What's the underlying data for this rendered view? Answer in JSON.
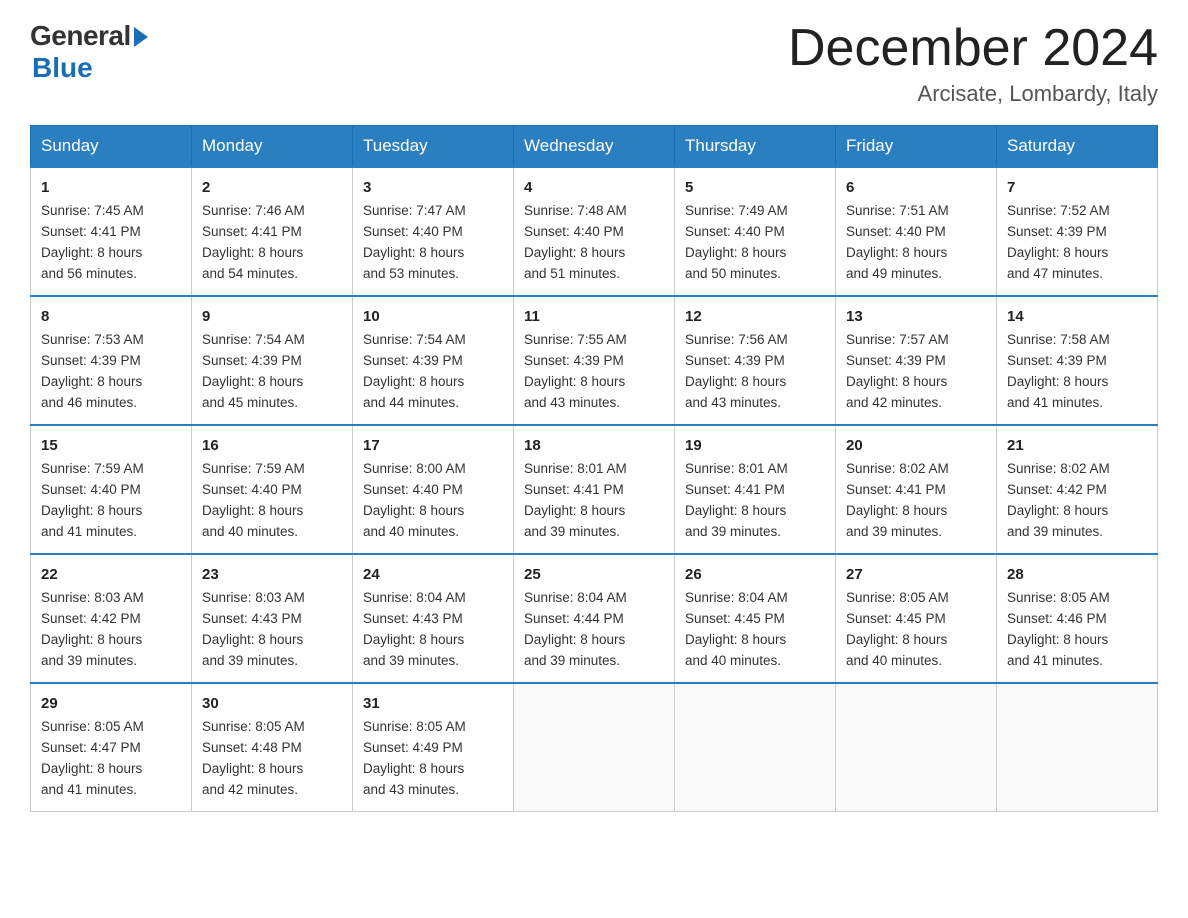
{
  "header": {
    "logo_general": "General",
    "logo_blue": "Blue",
    "month_title": "December 2024",
    "location": "Arcisate, Lombardy, Italy"
  },
  "days_of_week": [
    "Sunday",
    "Monday",
    "Tuesday",
    "Wednesday",
    "Thursday",
    "Friday",
    "Saturday"
  ],
  "weeks": [
    [
      {
        "day": "1",
        "sunrise": "7:45 AM",
        "sunset": "4:41 PM",
        "daylight": "8 hours and 56 minutes."
      },
      {
        "day": "2",
        "sunrise": "7:46 AM",
        "sunset": "4:41 PM",
        "daylight": "8 hours and 54 minutes."
      },
      {
        "day": "3",
        "sunrise": "7:47 AM",
        "sunset": "4:40 PM",
        "daylight": "8 hours and 53 minutes."
      },
      {
        "day": "4",
        "sunrise": "7:48 AM",
        "sunset": "4:40 PM",
        "daylight": "8 hours and 51 minutes."
      },
      {
        "day": "5",
        "sunrise": "7:49 AM",
        "sunset": "4:40 PM",
        "daylight": "8 hours and 50 minutes."
      },
      {
        "day": "6",
        "sunrise": "7:51 AM",
        "sunset": "4:40 PM",
        "daylight": "8 hours and 49 minutes."
      },
      {
        "day": "7",
        "sunrise": "7:52 AM",
        "sunset": "4:39 PM",
        "daylight": "8 hours and 47 minutes."
      }
    ],
    [
      {
        "day": "8",
        "sunrise": "7:53 AM",
        "sunset": "4:39 PM",
        "daylight": "8 hours and 46 minutes."
      },
      {
        "day": "9",
        "sunrise": "7:54 AM",
        "sunset": "4:39 PM",
        "daylight": "8 hours and 45 minutes."
      },
      {
        "day": "10",
        "sunrise": "7:54 AM",
        "sunset": "4:39 PM",
        "daylight": "8 hours and 44 minutes."
      },
      {
        "day": "11",
        "sunrise": "7:55 AM",
        "sunset": "4:39 PM",
        "daylight": "8 hours and 43 minutes."
      },
      {
        "day": "12",
        "sunrise": "7:56 AM",
        "sunset": "4:39 PM",
        "daylight": "8 hours and 43 minutes."
      },
      {
        "day": "13",
        "sunrise": "7:57 AM",
        "sunset": "4:39 PM",
        "daylight": "8 hours and 42 minutes."
      },
      {
        "day": "14",
        "sunrise": "7:58 AM",
        "sunset": "4:39 PM",
        "daylight": "8 hours and 41 minutes."
      }
    ],
    [
      {
        "day": "15",
        "sunrise": "7:59 AM",
        "sunset": "4:40 PM",
        "daylight": "8 hours and 41 minutes."
      },
      {
        "day": "16",
        "sunrise": "7:59 AM",
        "sunset": "4:40 PM",
        "daylight": "8 hours and 40 minutes."
      },
      {
        "day": "17",
        "sunrise": "8:00 AM",
        "sunset": "4:40 PM",
        "daylight": "8 hours and 40 minutes."
      },
      {
        "day": "18",
        "sunrise": "8:01 AM",
        "sunset": "4:41 PM",
        "daylight": "8 hours and 39 minutes."
      },
      {
        "day": "19",
        "sunrise": "8:01 AM",
        "sunset": "4:41 PM",
        "daylight": "8 hours and 39 minutes."
      },
      {
        "day": "20",
        "sunrise": "8:02 AM",
        "sunset": "4:41 PM",
        "daylight": "8 hours and 39 minutes."
      },
      {
        "day": "21",
        "sunrise": "8:02 AM",
        "sunset": "4:42 PM",
        "daylight": "8 hours and 39 minutes."
      }
    ],
    [
      {
        "day": "22",
        "sunrise": "8:03 AM",
        "sunset": "4:42 PM",
        "daylight": "8 hours and 39 minutes."
      },
      {
        "day": "23",
        "sunrise": "8:03 AM",
        "sunset": "4:43 PM",
        "daylight": "8 hours and 39 minutes."
      },
      {
        "day": "24",
        "sunrise": "8:04 AM",
        "sunset": "4:43 PM",
        "daylight": "8 hours and 39 minutes."
      },
      {
        "day": "25",
        "sunrise": "8:04 AM",
        "sunset": "4:44 PM",
        "daylight": "8 hours and 39 minutes."
      },
      {
        "day": "26",
        "sunrise": "8:04 AM",
        "sunset": "4:45 PM",
        "daylight": "8 hours and 40 minutes."
      },
      {
        "day": "27",
        "sunrise": "8:05 AM",
        "sunset": "4:45 PM",
        "daylight": "8 hours and 40 minutes."
      },
      {
        "day": "28",
        "sunrise": "8:05 AM",
        "sunset": "4:46 PM",
        "daylight": "8 hours and 41 minutes."
      }
    ],
    [
      {
        "day": "29",
        "sunrise": "8:05 AM",
        "sunset": "4:47 PM",
        "daylight": "8 hours and 41 minutes."
      },
      {
        "day": "30",
        "sunrise": "8:05 AM",
        "sunset": "4:48 PM",
        "daylight": "8 hours and 42 minutes."
      },
      {
        "day": "31",
        "sunrise": "8:05 AM",
        "sunset": "4:49 PM",
        "daylight": "8 hours and 43 minutes."
      },
      null,
      null,
      null,
      null
    ]
  ],
  "labels": {
    "sunrise": "Sunrise:",
    "sunset": "Sunset:",
    "daylight": "Daylight:"
  }
}
